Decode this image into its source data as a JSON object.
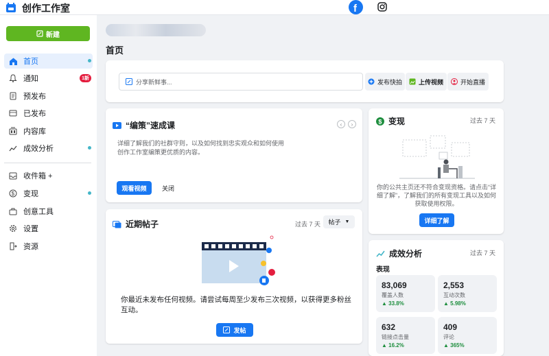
{
  "app": {
    "title": "创作工作室"
  },
  "sidebar": {
    "new_label": "新建",
    "items": [
      {
        "label": "首页"
      },
      {
        "label": "通知",
        "badge": "1新"
      },
      {
        "label": "预发布"
      },
      {
        "label": "已发布"
      },
      {
        "label": "内容库"
      },
      {
        "label": "成效分析"
      },
      {
        "label": "收件箱 +"
      },
      {
        "label": "变现"
      },
      {
        "label": "创意工具"
      },
      {
        "label": "设置"
      },
      {
        "label": "资源"
      }
    ]
  },
  "page": {
    "title": "首页"
  },
  "composer": {
    "placeholder": "分享新鲜事...",
    "actions": [
      "发布快拍",
      "上传视频",
      "开始直播"
    ]
  },
  "course": {
    "title": "“编策”速成课",
    "description": "详细了解我们的社群守则，以及如何找到忠实观众和如何使用创作工作室编策更优质的内容。",
    "watch_label": "观看视频",
    "close_label": "关闭"
  },
  "recent_posts": {
    "title": "近期帖子",
    "period": "过去 7 天",
    "filter": "帖子",
    "message": "你最近未发布任何视频。请尝试每周至少发布三次视频，以获得更多粉丝互动。",
    "post_label": "发帖"
  },
  "monetize": {
    "title": "变现",
    "period": "过去 7 天",
    "message": "你的公共主页还不符合变现资格。请点击“详细了解”，了解我们的所有变现工具以及如何获取使用权限。",
    "learn_label": "详细了解"
  },
  "insights": {
    "title": "成效分析",
    "period": "过去 7 天",
    "section": "表现",
    "metrics": [
      {
        "value": "83,069",
        "label": "覆盖人数",
        "change": "33.8%"
      },
      {
        "value": "2,553",
        "label": "互动次数",
        "change": "5.98%"
      },
      {
        "value": "632",
        "label": "链接点击量",
        "change": "16.2%"
      },
      {
        "value": "409",
        "label": "评论",
        "change": "365%"
      }
    ]
  },
  "colors": {
    "accent": "#1877f2",
    "new_button": "#5fb621",
    "positive": "#1e8e3e",
    "badge": "#e41e3f"
  }
}
